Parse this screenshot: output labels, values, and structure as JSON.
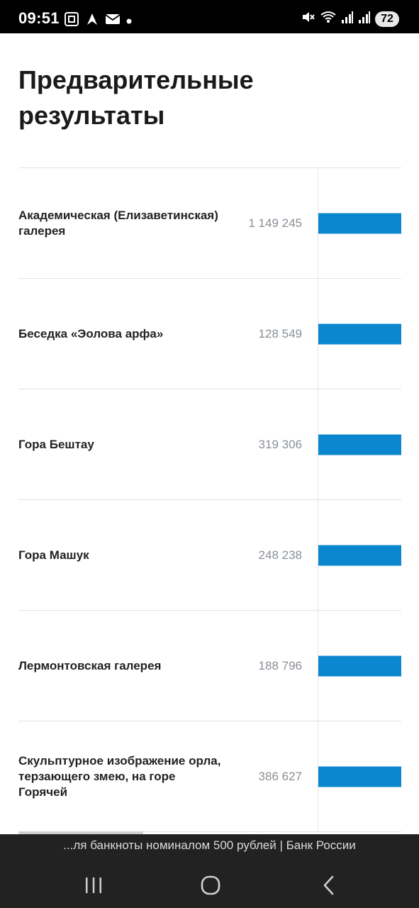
{
  "status_bar": {
    "time": "09:51",
    "battery": "72",
    "left_icons": [
      "screenshot-icon",
      "navigation-icon",
      "mail-icon",
      "dot-icon"
    ],
    "right_icons": [
      "mute-icon",
      "wifi-icon",
      "signal-icon",
      "signal-icon"
    ]
  },
  "page": {
    "title_line1": "Предварительные",
    "title_line2": "результаты"
  },
  "results": [
    {
      "label": "Академическая (Елизаветинская) галерея",
      "value": "1 149 245",
      "bar_fraction": 1.0
    },
    {
      "label": "Беседка «Эолова арфа»",
      "value": "128 549",
      "bar_fraction": 1.0
    },
    {
      "label": "Гора Бештау",
      "value": "319 306",
      "bar_fraction": 1.0
    },
    {
      "label": "Гора Машук",
      "value": "248 238",
      "bar_fraction": 1.0
    },
    {
      "label": "Лермонтовская галерея",
      "value": "188 796",
      "bar_fraction": 1.0
    },
    {
      "label": "Скульптурное изображение орла, терзающего змею, на горе Горячей",
      "value": "386 627",
      "bar_fraction": 1.0
    }
  ],
  "colors": {
    "bar": "#0b87cf",
    "value_text": "#8a8f96"
  },
  "ticker": {
    "text": "...ля банкноты номиналом 500 рублей | Банк России"
  },
  "navbar": {
    "icons": [
      "recent-apps-icon",
      "home-icon",
      "back-icon"
    ]
  }
}
